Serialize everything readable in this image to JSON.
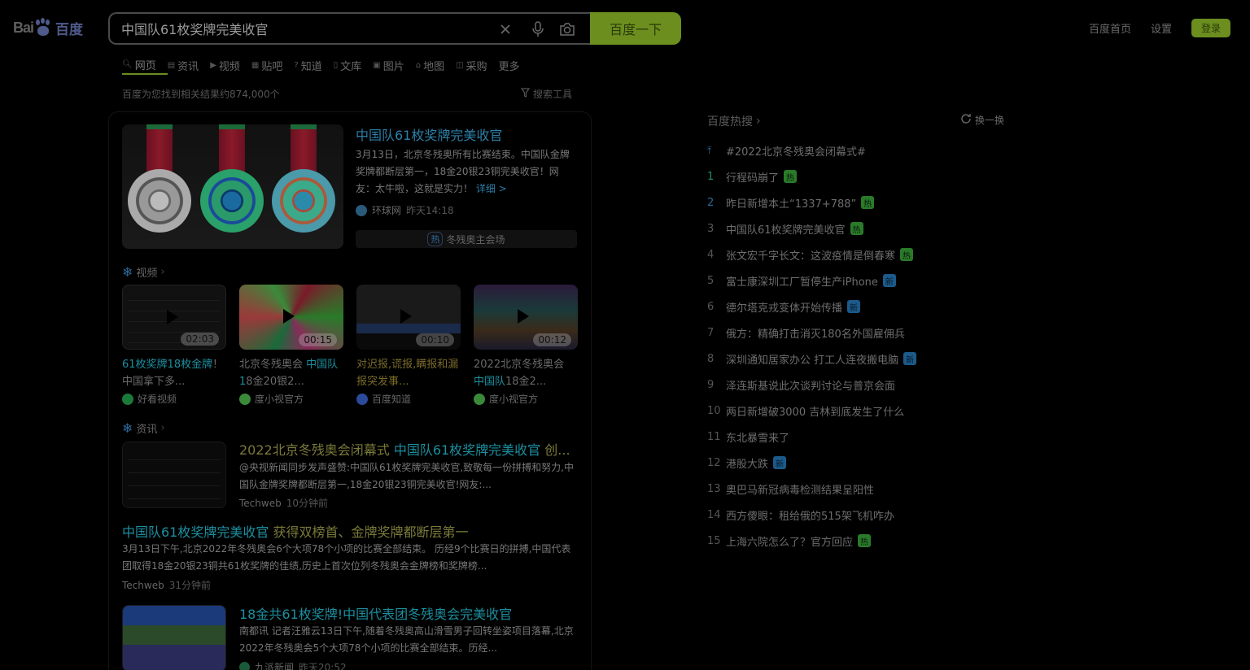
{
  "logo": {
    "text_left": "Bai",
    "text_right": "百度"
  },
  "search": {
    "query": "中国队61枚奖牌完美收官",
    "button_label": "百度一下"
  },
  "top_links": [
    "百度首页",
    "设置"
  ],
  "login_label": "登录",
  "tabs": [
    {
      "label": "网页",
      "icon": "search-icon"
    },
    {
      "label": "资讯",
      "icon": "news-icon"
    },
    {
      "label": "视频",
      "icon": "video-icon"
    },
    {
      "label": "贴吧",
      "icon": "tieba-icon"
    },
    {
      "label": "知道",
      "icon": "question-icon"
    },
    {
      "label": "文库",
      "icon": "doc-icon"
    },
    {
      "label": "图片",
      "icon": "image-icon"
    },
    {
      "label": "地图",
      "icon": "map-icon"
    },
    {
      "label": "采购",
      "icon": "bag-icon"
    },
    {
      "label": "更多",
      "icon": ""
    }
  ],
  "result_count": "百度为您找到相关结果约874,000个",
  "search_tools": "搜索工具",
  "top_result": {
    "title": "中国队61枚奖牌完美收官",
    "abstract": "3月13日，北京冬残奥所有比赛结束。中国队金牌奖牌都断层第一，18金20银23铜完美收官！网友：太牛啦，这就是实力！",
    "more": "详细 >",
    "source": "环球网",
    "time": "昨天14:18",
    "related_tag": "热",
    "related_text": "冬残奥主会场"
  },
  "video_section": {
    "label": "视频",
    "items": [
      {
        "title_hl": "61枚奖牌18枚金牌",
        "title_rest": "！中国拿下多...",
        "source": "好看视频",
        "duration": "02:03"
      },
      {
        "title_pre": "北京冬残奥会 ",
        "title_hl": "中国队1",
        "title_rest": "8金20银2...",
        "source": "度小视官方",
        "duration": "00:15"
      },
      {
        "title_pre": "对迟报,谎报,瞒报和漏报突发事...",
        "source": "百度知道",
        "duration": "00:10"
      },
      {
        "title_pre": "2022北京冬残奥会 ",
        "title_hl": "中国队",
        "title_rest": "18金2...",
        "source": "度小视官方",
        "duration": "00:12"
      }
    ]
  },
  "news_section": {
    "label": "资讯",
    "items": [
      {
        "title_pre": "2022北京冬残奥会闭幕式 ",
        "title_hl": "中国队61枚奖牌完美收官",
        "title_rest": " 创...",
        "abstract": "@央视新闻同步发声盛赞:中国队61枚奖牌完美收官,致敬每一份拼搏和努力,中国队金牌奖牌都断层第一,18金20银23铜完美收官!网友:...",
        "source": "Techweb",
        "time": "10分钟前"
      },
      {
        "title_hl": "中国队61枚奖牌完美收官",
        "title_rest": " 获得双榜首、金牌奖牌都断层第一",
        "abstract": "3月13日下午,北京2022年冬残奥会6个大项78个小项的比赛全部结束。 历经9个比赛日的拼搏,中国代表团取得18金20银23铜共61枚奖牌的佳绩,历史上首次位列冬残奥会金牌榜和奖牌榜...",
        "source": "Techweb",
        "time": "31分钟前"
      },
      {
        "title_pre": "18金共",
        "title_hl": "61枚奖牌",
        "title_rest": "!中国代表团冬残奥会完美收官",
        "abstract": "南都讯 记者汪雅云13日下午,随着冬残奥高山滑雪男子回转坐姿项目落幕,北京2022年冬残奥会5个大项78个小项的比赛全部结束。历经...",
        "source": "九派新闻",
        "time": "昨天20:52"
      }
    ]
  },
  "hot": {
    "title": "百度热搜",
    "refresh": "换一换",
    "items": [
      {
        "rank": "pin",
        "text": "#2022北京冬残奥会闭幕式#",
        "badge": ""
      },
      {
        "rank": "1",
        "text": "行程码崩了",
        "badge": "热"
      },
      {
        "rank": "2",
        "text": "昨日新增本土“1337+788”",
        "badge": "热"
      },
      {
        "rank": "3",
        "text": "中国队61枚奖牌完美收官",
        "badge": "热"
      },
      {
        "rank": "4",
        "text": "张文宏千字长文：这波疫情是倒春寒",
        "badge": "热"
      },
      {
        "rank": "5",
        "text": "富士康深圳工厂暂停生产iPhone",
        "badge": "新"
      },
      {
        "rank": "6",
        "text": "德尔塔克戎变体开始传播",
        "badge": "新"
      },
      {
        "rank": "7",
        "text": "俄方：精确打击消灭180名外国雇佣兵",
        "badge": ""
      },
      {
        "rank": "8",
        "text": "深圳通知居家办公 打工人连夜搬电脑",
        "badge": "新"
      },
      {
        "rank": "9",
        "text": "泽连斯基说此次谈判讨论与普京会面",
        "badge": ""
      },
      {
        "rank": "10",
        "text": "两日新增破3000 吉林到底发生了什么",
        "badge": ""
      },
      {
        "rank": "11",
        "text": "东北暴雪来了",
        "badge": ""
      },
      {
        "rank": "12",
        "text": "港股大跌",
        "badge": "新"
      },
      {
        "rank": "13",
        "text": "奥巴马新冠病毒检测结果呈阳性",
        "badge": ""
      },
      {
        "rank": "14",
        "text": "西方傻眼：租给俄的515架飞机咋办",
        "badge": ""
      },
      {
        "rank": "15",
        "text": "上海六院怎么了？官方回应",
        "badge": "热"
      }
    ]
  }
}
